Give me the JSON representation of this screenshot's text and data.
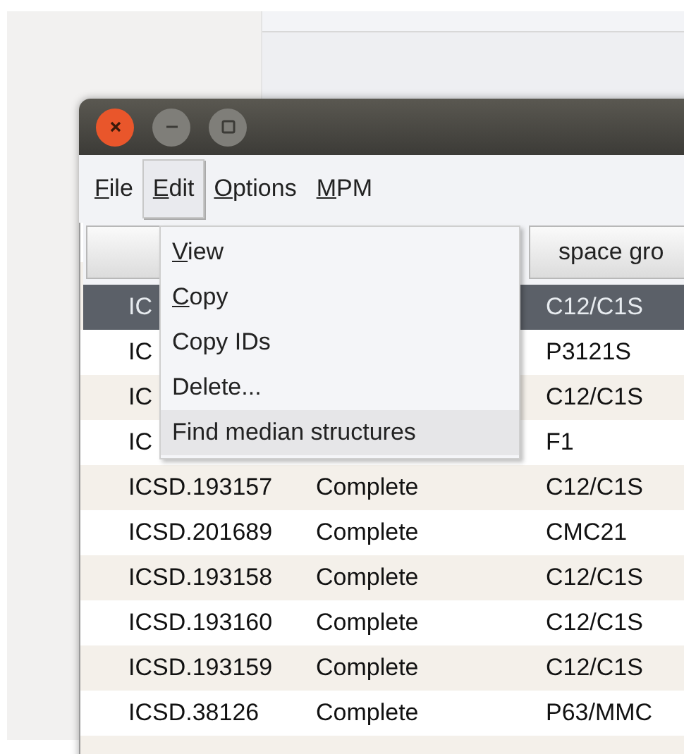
{
  "window": {
    "controls": [
      {
        "kind": "close"
      },
      {
        "kind": "minimize"
      },
      {
        "kind": "maximize"
      }
    ]
  },
  "menubar": [
    {
      "label": "File",
      "mnemonic": true,
      "selected": false
    },
    {
      "label": "Edit",
      "mnemonic": true,
      "selected": true
    },
    {
      "label": "Options",
      "mnemonic": true,
      "selected": false
    },
    {
      "label": "MPM",
      "mnemonic": true,
      "selected": false
    }
  ],
  "menu": [
    {
      "label": "View",
      "mnemonic": true,
      "selected": false
    },
    {
      "label": "Copy",
      "mnemonic": true,
      "selected": false
    },
    {
      "label": "Copy IDs",
      "mnemonic": false,
      "selected": false
    },
    {
      "label": "Delete...",
      "mnemonic": false,
      "selected": false
    },
    {
      "label": "Find median structures",
      "mnemonic": false,
      "selected": true
    }
  ],
  "table": {
    "header_label": "space gro",
    "rows": [
      {
        "id": "IC",
        "space_group": "C12/C1S",
        "selected": true
      },
      {
        "id": "IC",
        "space_group": "P3121S",
        "selected": false
      },
      {
        "id": "IC",
        "space_group": "C12/C1S",
        "selected": false
      },
      {
        "id": "IC",
        "space_group": "F1",
        "selected": false
      },
      {
        "id": "ICSD.193157",
        "status": "Complete",
        "space_group": "C12/C1S",
        "selected": false
      },
      {
        "id": "ICSD.201689",
        "status": "Complete",
        "space_group": "CMC21",
        "selected": false
      },
      {
        "id": "ICSD.193158",
        "status": "Complete",
        "space_group": "C12/C1S",
        "selected": false
      },
      {
        "id": "ICSD.193160",
        "status": "Complete",
        "space_group": "C12/C1S",
        "selected": false
      },
      {
        "id": "ICSD.193159",
        "status": "Complete",
        "space_group": "C12/C1S",
        "selected": false
      },
      {
        "id": "ICSD.38126",
        "status": "Complete",
        "space_group": "P63/MMC",
        "selected": false
      }
    ]
  }
}
